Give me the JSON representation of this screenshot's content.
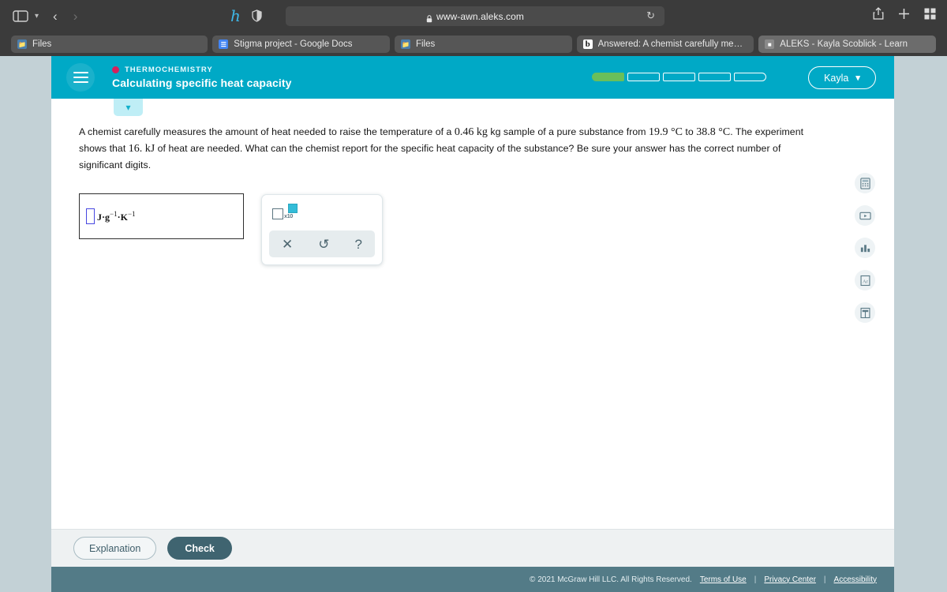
{
  "browser": {
    "url": "www-awn.aleks.com",
    "icons": {
      "sidebar": "sidebar-toggle-icon",
      "dropdown": "chevron-down-icon",
      "back": "back-arrow-icon",
      "forward": "forward-arrow-icon",
      "hypothesis": "hypothesis-icon",
      "shield": "shield-icon",
      "lock": "lock-icon",
      "reload": "reload-icon",
      "share": "share-icon",
      "new_tab": "plus-icon",
      "tab_overview": "grid-icon"
    },
    "tabs": [
      {
        "title": "Files",
        "favicon": "files-icon",
        "active": false
      },
      {
        "title": "Stigma project - Google Docs",
        "favicon": "google-docs-icon",
        "active": false
      },
      {
        "title": "Files",
        "favicon": "files-icon",
        "active": false
      },
      {
        "title": "Answered: A chemist carefully measure...",
        "favicon": "brainly-icon",
        "active": false
      },
      {
        "title": "ALEKS - Kayla Scoblick - Learn",
        "favicon": "aleks-icon",
        "active": true
      }
    ]
  },
  "header": {
    "menu_icon": "hamburger-menu-icon",
    "topic": "THERMOCHEMISTRY",
    "topic_dot_color": "#d6205c",
    "title": "Calculating specific heat capacity",
    "accent_color": "#00a9c6",
    "user_name": "Kayla",
    "user_caret": "⌄",
    "progress": {
      "total_segments": 5,
      "filled_segments": 1,
      "fill_color": "#6abf5a"
    },
    "expander_icon": "chevron-down-icon"
  },
  "question": {
    "part1": "A chemist carefully measures the amount of heat needed to raise the temperature of a ",
    "mass": "0.46",
    "part2": " kg sample of a pure substance from ",
    "temp_start": "19.9",
    "unit_start": " °C",
    "part3": " to ",
    "temp_end": "38.8",
    "unit_end": " °C",
    "part4": ". The experiment shows that ",
    "heat": "16.",
    "heat_unit": " kJ",
    "part5": " of heat are needed. What can the chemist report for the specific heat capacity of the substance? Be sure your answer has the correct number of significant digits."
  },
  "answer": {
    "input_value": "",
    "input_placeholder": "",
    "units_j": "J",
    "units_dot1": "·",
    "units_g": "g",
    "units_exp1": "−1",
    "units_dot2": "·",
    "units_k": "K",
    "units_exp2": "−1"
  },
  "tool_panel": {
    "sci_notation_label": "x10",
    "sci_notation_name": "scientific-notation-button",
    "clear": "✕",
    "undo": "↺",
    "help": "?"
  },
  "right_rail": [
    {
      "name": "calculator-icon",
      "label": "Calculator"
    },
    {
      "name": "video-tutorial-icon",
      "label": "Video"
    },
    {
      "name": "data-chart-icon",
      "label": "Data"
    },
    {
      "name": "periodic-table-icon",
      "label": "Ar"
    },
    {
      "name": "reference-book-icon",
      "label": "Reference"
    }
  ],
  "actions": {
    "explanation": "Explanation",
    "check": "Check"
  },
  "footer": {
    "copyright": "© 2021 McGraw Hill LLC. All Rights Reserved.",
    "links": [
      "Terms of Use",
      "Privacy Center",
      "Accessibility"
    ],
    "separator": "|",
    "background": "#537b87"
  }
}
